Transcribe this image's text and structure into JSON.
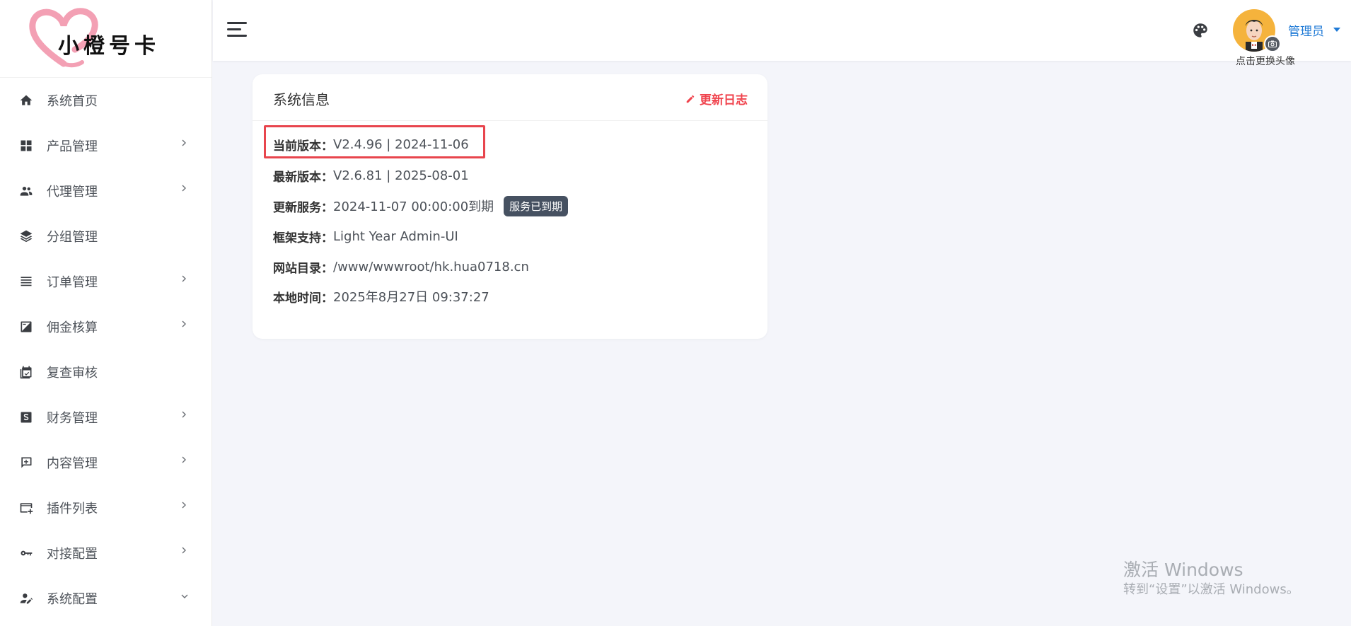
{
  "brand": {
    "logo_text": "小橙号卡"
  },
  "sidebar": {
    "items": [
      {
        "label": "系统首页",
        "icon": "home-icon",
        "has_submenu": false
      },
      {
        "label": "产品管理",
        "icon": "grid-icon",
        "has_submenu": true
      },
      {
        "label": "代理管理",
        "icon": "users-icon",
        "has_submenu": true
      },
      {
        "label": "分组管理",
        "icon": "layers-icon",
        "has_submenu": false
      },
      {
        "label": "订单管理",
        "icon": "list-icon",
        "has_submenu": true
      },
      {
        "label": "佣金核算",
        "icon": "calculator-icon",
        "has_submenu": true
      },
      {
        "label": "复查审核",
        "icon": "calendar-check-icon",
        "has_submenu": false
      },
      {
        "label": "财务管理",
        "icon": "dollar-icon",
        "has_submenu": true
      },
      {
        "label": "内容管理",
        "icon": "message-plus-icon",
        "has_submenu": true
      },
      {
        "label": "插件列表",
        "icon": "card-plus-icon",
        "has_submenu": true
      },
      {
        "label": "对接配置",
        "icon": "key-icon",
        "has_submenu": true
      },
      {
        "label": "系统配置",
        "icon": "user-edit-icon",
        "has_submenu": true,
        "expanded": true
      }
    ]
  },
  "header": {
    "avatar_caption": "点击更换头像",
    "user_name": "管理员"
  },
  "card": {
    "title": "系统信息",
    "action_label": "更新日志",
    "rows": [
      {
        "key": "当前版本：",
        "value": "V2.4.96 | 2024-11-06"
      },
      {
        "key": "最新版本：",
        "value": "V2.6.81 | 2025-08-01"
      },
      {
        "key": "更新服务：",
        "value": "2024-11-07 00:00:00到期",
        "badge": "服务已到期"
      },
      {
        "key": "框架支持：",
        "value": "Light Year Admin-UI"
      },
      {
        "key": "网站目录：",
        "value": "/www/wwwroot/hk.hua0718.cn"
      },
      {
        "key": "本地时间：",
        "value": "2025年8月27日 09:37:27"
      }
    ]
  },
  "watermark": {
    "title": "激活 Windows",
    "subtitle": "转到“设置”以激活 Windows。"
  },
  "colors": {
    "accent_red": "#f0444e",
    "link_blue": "#1f7ad6",
    "badge_bg": "#465161",
    "page_bg": "#f4f5fa"
  }
}
